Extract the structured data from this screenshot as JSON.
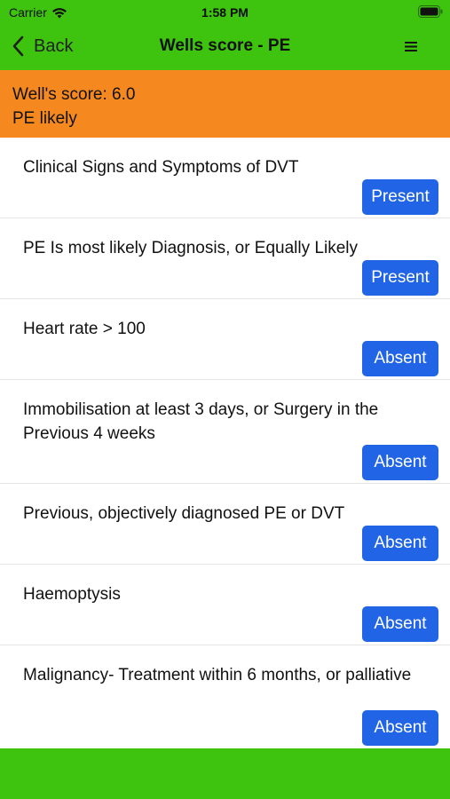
{
  "status_bar": {
    "carrier": "Carrier",
    "time": "1:58 PM",
    "icons": [
      "wifi-icon",
      "battery-icon"
    ]
  },
  "nav": {
    "back_label": "Back",
    "title": "Wells score - PE",
    "menu_icon": "menu-icon"
  },
  "banner": {
    "score_text": "Well's score: 6.0",
    "result_text": "PE likely"
  },
  "criteria": [
    {
      "label": "Clinical Signs and Symptoms of DVT",
      "state": "Present"
    },
    {
      "label": "PE Is most likely Diagnosis, or Equally Likely",
      "state": "Present"
    },
    {
      "label": "Heart rate > 100",
      "state": "Absent"
    },
    {
      "label": "Immobilisation at least 3 days, or Surgery in the Previous 4 weeks",
      "state": "Absent"
    },
    {
      "label": "Previous, objectively diagnosed PE or DVT",
      "state": "Absent"
    },
    {
      "label": "Haemoptysis",
      "state": "Absent"
    },
    {
      "label": "Malignancy- Treatment within 6 months, or palliative",
      "state": "Absent"
    }
  ],
  "colors": {
    "header_green": "#3ec30f",
    "banner_orange": "#f5891f",
    "button_blue": "#2264e6"
  }
}
